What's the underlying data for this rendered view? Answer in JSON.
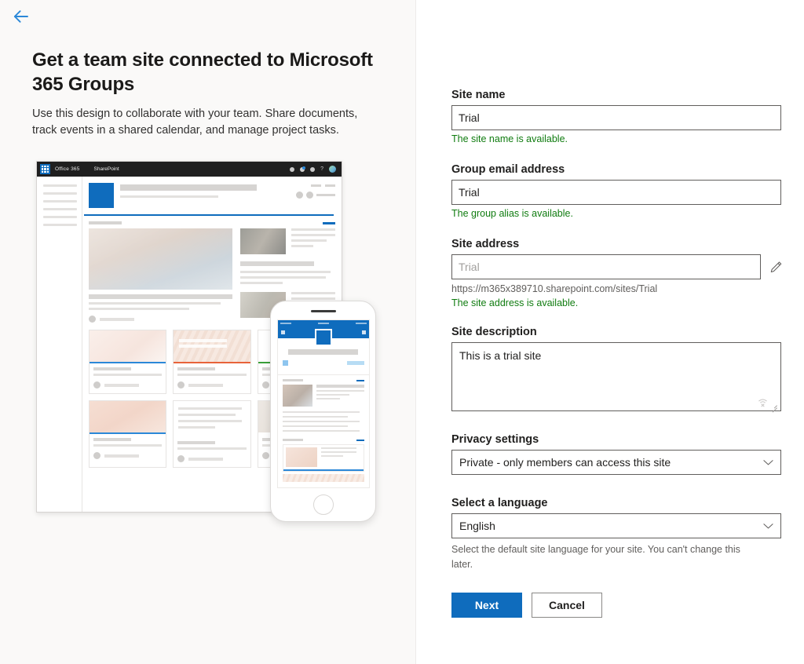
{
  "nav": {
    "back_label": "Back",
    "back_icon": "arrow-left-icon"
  },
  "left": {
    "headline": "Get a team site connected to Microsoft 365 Groups",
    "subhead": "Use this design to collaborate with your team. Share documents, track events in a shared calendar, and manage project tasks.",
    "illustration": {
      "desktop_mock": {
        "brand": "Office 365",
        "app": "SharePoint",
        "waffle_icon": "waffle-icon",
        "icons": [
          "bell-icon",
          "settings-accent-icon",
          "apps-icon",
          "help-icon",
          "user-avatar-icon"
        ],
        "card_accents": [
          "#2b88d8",
          "#e8633a",
          "#3aa03a",
          "#2b88d8",
          "#ffffff",
          "#ffffff"
        ]
      },
      "phone_mock": {
        "accent": "#0f6cbd"
      }
    }
  },
  "form": {
    "site_name": {
      "label": "Site name",
      "value": "Trial",
      "placeholder": "",
      "validation": "The site name is available.",
      "validation_color": "#107c10"
    },
    "group_email": {
      "label": "Group email address",
      "value": "Trial",
      "placeholder": "",
      "validation": "The group alias is available.",
      "validation_color": "#107c10"
    },
    "site_address": {
      "label": "Site address",
      "value": "Trial",
      "placeholder": "Trial",
      "url": "https://m365x389710.sharepoint.com/sites/Trial",
      "validation": "The site address is available.",
      "validation_color": "#107c10",
      "edit_icon": "pencil-icon"
    },
    "site_description": {
      "label": "Site description",
      "value": "This is a trial site",
      "placeholder": "",
      "corner_icon": "dictation-off-icon",
      "resize_icon": "resize-grip-icon"
    },
    "privacy": {
      "label": "Privacy settings",
      "value": "Private - only members can access this site",
      "chevron_icon": "chevron-down-icon"
    },
    "language": {
      "label": "Select a language",
      "value": "English",
      "chevron_icon": "chevron-down-icon",
      "hint": "Select the default site language for your site. You can't change this later."
    },
    "buttons": {
      "next": "Next",
      "cancel": "Cancel",
      "primary_color": "#0f6cbd"
    }
  }
}
